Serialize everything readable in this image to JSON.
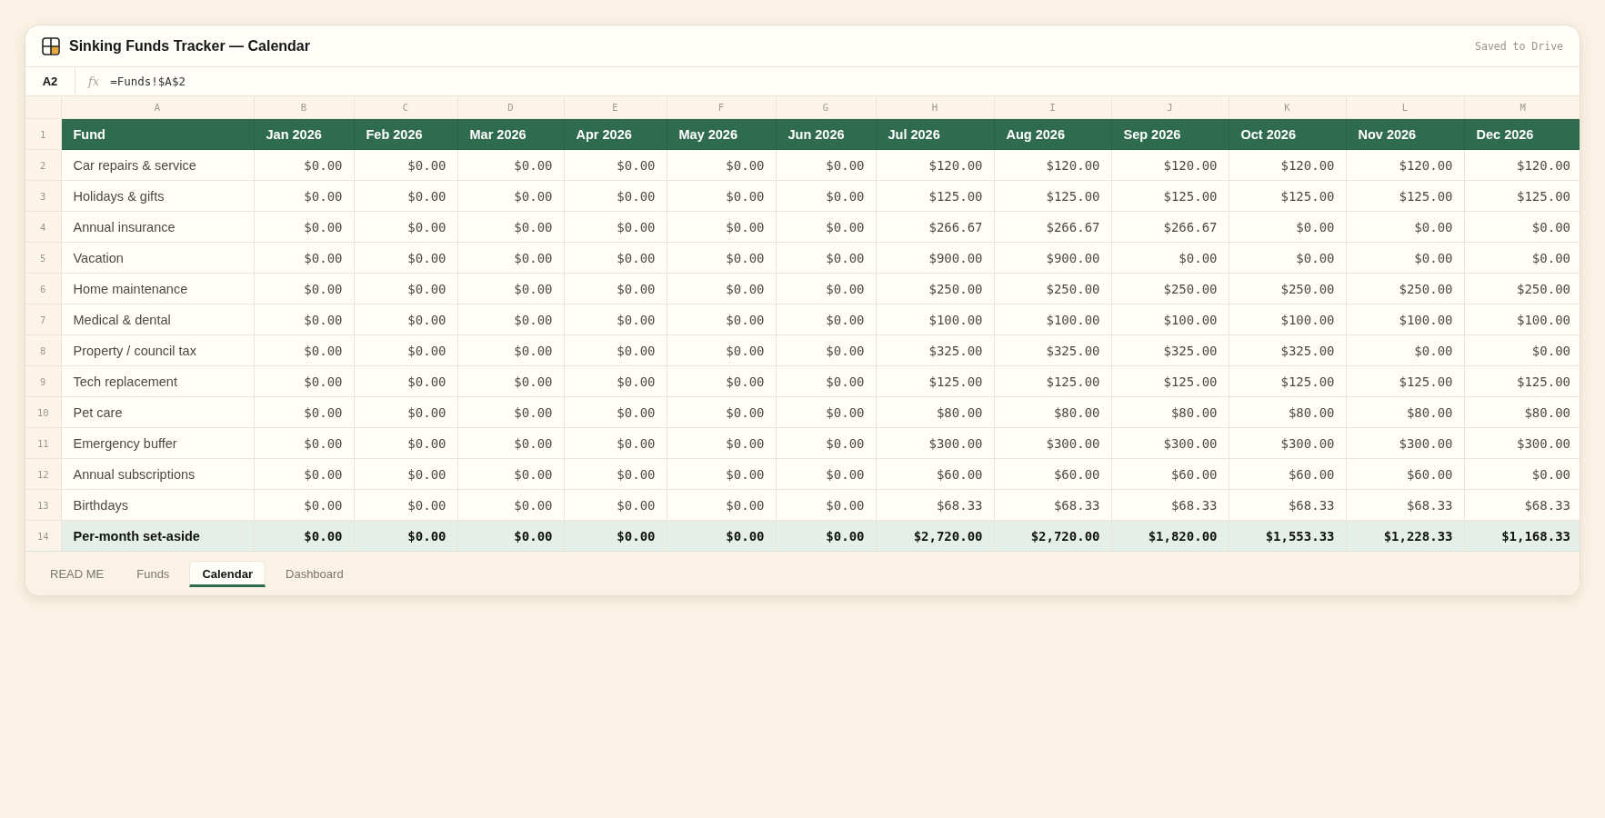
{
  "window": {
    "title": "Sinking Funds Tracker — Calendar",
    "status": "Saved to Drive"
  },
  "formula_bar": {
    "cell_ref": "A2",
    "fx_label": "fx",
    "formula": "=Funds!$A$2"
  },
  "sheet": {
    "column_letters": [
      "A",
      "B",
      "C",
      "D",
      "E",
      "F",
      "G",
      "H",
      "I",
      "J",
      "K",
      "L",
      "M"
    ],
    "rows": [
      {
        "number": "1",
        "kind": "header",
        "cells": [
          "Fund",
          "Jan 2026",
          "Feb 2026",
          "Mar 2026",
          "Apr 2026",
          "May 2026",
          "Jun 2026",
          "Jul 2026",
          "Aug 2026",
          "Sep 2026",
          "Oct 2026",
          "Nov 2026",
          "Dec 2026"
        ]
      },
      {
        "number": "2",
        "kind": "data",
        "cells": [
          "Car repairs & service",
          "$0.00",
          "$0.00",
          "$0.00",
          "$0.00",
          "$0.00",
          "$0.00",
          "$120.00",
          "$120.00",
          "$120.00",
          "$120.00",
          "$120.00",
          "$120.00"
        ]
      },
      {
        "number": "3",
        "kind": "data",
        "cells": [
          "Holidays & gifts",
          "$0.00",
          "$0.00",
          "$0.00",
          "$0.00",
          "$0.00",
          "$0.00",
          "$125.00",
          "$125.00",
          "$125.00",
          "$125.00",
          "$125.00",
          "$125.00"
        ]
      },
      {
        "number": "4",
        "kind": "data",
        "cells": [
          "Annual insurance",
          "$0.00",
          "$0.00",
          "$0.00",
          "$0.00",
          "$0.00",
          "$0.00",
          "$266.67",
          "$266.67",
          "$266.67",
          "$0.00",
          "$0.00",
          "$0.00"
        ]
      },
      {
        "number": "5",
        "kind": "data",
        "cells": [
          "Vacation",
          "$0.00",
          "$0.00",
          "$0.00",
          "$0.00",
          "$0.00",
          "$0.00",
          "$900.00",
          "$900.00",
          "$0.00",
          "$0.00",
          "$0.00",
          "$0.00"
        ]
      },
      {
        "number": "6",
        "kind": "data",
        "cells": [
          "Home maintenance",
          "$0.00",
          "$0.00",
          "$0.00",
          "$0.00",
          "$0.00",
          "$0.00",
          "$250.00",
          "$250.00",
          "$250.00",
          "$250.00",
          "$250.00",
          "$250.00"
        ]
      },
      {
        "number": "7",
        "kind": "data",
        "cells": [
          "Medical & dental",
          "$0.00",
          "$0.00",
          "$0.00",
          "$0.00",
          "$0.00",
          "$0.00",
          "$100.00",
          "$100.00",
          "$100.00",
          "$100.00",
          "$100.00",
          "$100.00"
        ]
      },
      {
        "number": "8",
        "kind": "data",
        "cells": [
          "Property / council tax",
          "$0.00",
          "$0.00",
          "$0.00",
          "$0.00",
          "$0.00",
          "$0.00",
          "$325.00",
          "$325.00",
          "$325.00",
          "$325.00",
          "$0.00",
          "$0.00"
        ]
      },
      {
        "number": "9",
        "kind": "data",
        "cells": [
          "Tech replacement",
          "$0.00",
          "$0.00",
          "$0.00",
          "$0.00",
          "$0.00",
          "$0.00",
          "$125.00",
          "$125.00",
          "$125.00",
          "$125.00",
          "$125.00",
          "$125.00"
        ]
      },
      {
        "number": "10",
        "kind": "data",
        "cells": [
          "Pet care",
          "$0.00",
          "$0.00",
          "$0.00",
          "$0.00",
          "$0.00",
          "$0.00",
          "$80.00",
          "$80.00",
          "$80.00",
          "$80.00",
          "$80.00",
          "$80.00"
        ]
      },
      {
        "number": "11",
        "kind": "data",
        "cells": [
          "Emergency buffer",
          "$0.00",
          "$0.00",
          "$0.00",
          "$0.00",
          "$0.00",
          "$0.00",
          "$300.00",
          "$300.00",
          "$300.00",
          "$300.00",
          "$300.00",
          "$300.00"
        ]
      },
      {
        "number": "12",
        "kind": "data",
        "cells": [
          "Annual subscriptions",
          "$0.00",
          "$0.00",
          "$0.00",
          "$0.00",
          "$0.00",
          "$0.00",
          "$60.00",
          "$60.00",
          "$60.00",
          "$60.00",
          "$60.00",
          "$0.00"
        ]
      },
      {
        "number": "13",
        "kind": "data",
        "cells": [
          "Birthdays",
          "$0.00",
          "$0.00",
          "$0.00",
          "$0.00",
          "$0.00",
          "$0.00",
          "$68.33",
          "$68.33",
          "$68.33",
          "$68.33",
          "$68.33",
          "$68.33"
        ]
      },
      {
        "number": "14",
        "kind": "total",
        "cells": [
          "Per-month set-aside",
          "$0.00",
          "$0.00",
          "$0.00",
          "$0.00",
          "$0.00",
          "$0.00",
          "$2,720.00",
          "$2,720.00",
          "$1,820.00",
          "$1,553.33",
          "$1,228.33",
          "$1,168.33"
        ]
      }
    ]
  },
  "tabs": [
    {
      "label": "READ ME",
      "selected": false
    },
    {
      "label": "Funds",
      "selected": false
    },
    {
      "label": "Calendar",
      "selected": true
    },
    {
      "label": "Dashboard",
      "selected": false
    }
  ]
}
